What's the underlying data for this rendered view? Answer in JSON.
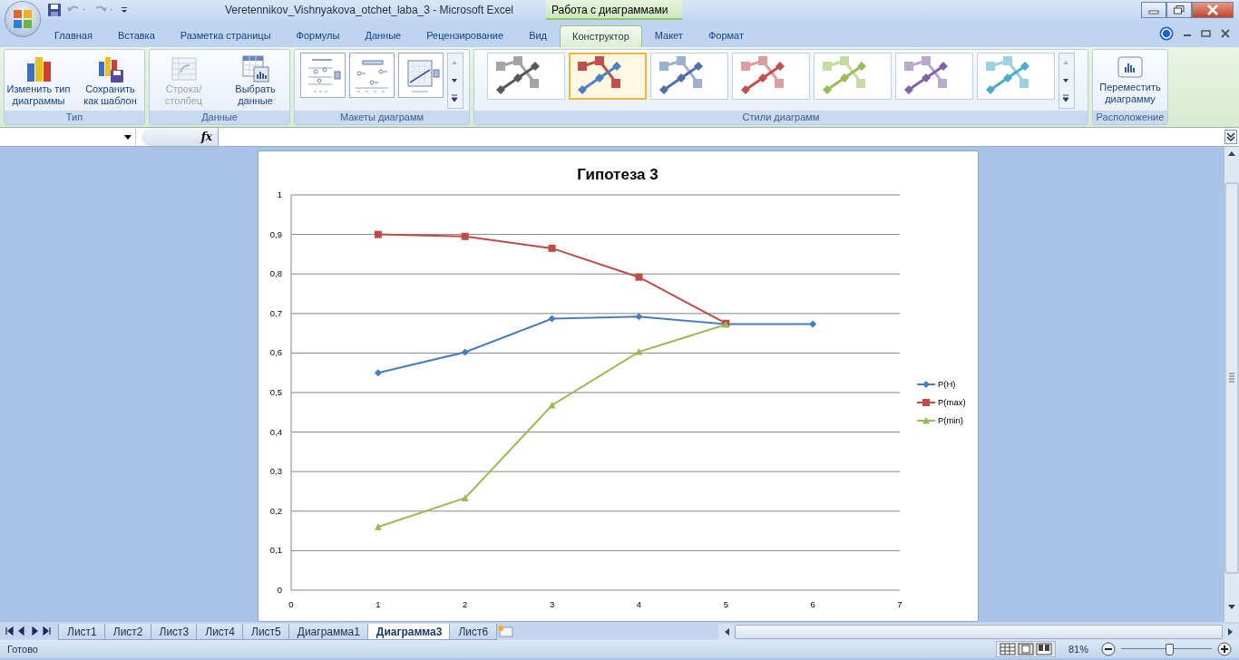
{
  "window": {
    "title": "Veretennikov_Vishnyakova_otchet_laba_3 - Microsoft Excel",
    "context_title": "Работа с диаграммами"
  },
  "tabs": [
    {
      "label": "Главная",
      "selected": false
    },
    {
      "label": "Вставка",
      "selected": false
    },
    {
      "label": "Разметка страницы",
      "selected": false
    },
    {
      "label": "Формулы",
      "selected": false
    },
    {
      "label": "Данные",
      "selected": false
    },
    {
      "label": "Рецензирование",
      "selected": false
    },
    {
      "label": "Вид",
      "selected": false
    },
    {
      "label": "Конструктор",
      "selected": true
    },
    {
      "label": "Макет",
      "selected": false
    },
    {
      "label": "Формат",
      "selected": false
    }
  ],
  "ribbon": {
    "groups": [
      {
        "title": "Тип",
        "kind": "buttons",
        "buttons": [
          {
            "label": "Изменить тип диаграммы",
            "kind": "bars",
            "disabled": false
          },
          {
            "label": "Сохранить как шаблон",
            "kind": "save",
            "disabled": false
          }
        ]
      },
      {
        "title": "Данные",
        "kind": "buttons",
        "buttons": [
          {
            "label": "Строка/столбец",
            "kind": "switch",
            "disabled": true
          },
          {
            "label": "Выбрать данные",
            "kind": "table",
            "disabled": false
          }
        ]
      },
      {
        "title": "Макеты диаграмм",
        "kind": "layouts"
      },
      {
        "title": "Стили диаграмм",
        "kind": "styles",
        "styles": [
          {
            "kind": "mono",
            "color": "#595959",
            "selected": false
          },
          {
            "kind": "multi",
            "color": "#4f81bd",
            "selected": true
          },
          {
            "kind": "mono",
            "color": "#4f6fa8",
            "selected": false
          },
          {
            "kind": "mono",
            "color": "#c0504d",
            "selected": false
          },
          {
            "kind": "mono",
            "color": "#9bbb59",
            "selected": false
          },
          {
            "kind": "mono",
            "color": "#8064a2",
            "selected": false
          },
          {
            "kind": "mono",
            "color": "#4bacc6",
            "selected": false
          }
        ]
      },
      {
        "title": "Расположение",
        "kind": "buttons",
        "buttons": [
          {
            "label": "Переместить диаграмму",
            "kind": "move",
            "disabled": false
          }
        ]
      }
    ]
  },
  "formula_bar": {
    "fx": "fx"
  },
  "chart": {
    "chart_data": {
      "type": "line",
      "title": "Гипотеза 3",
      "x": [
        1,
        2,
        3,
        4,
        5,
        6
      ],
      "series": [
        {
          "name": "P(H)",
          "color": "#4a7ebb",
          "marker": "diamond",
          "values": [
            0.55,
            0.602,
            0.687,
            0.692,
            0.673,
            0.673
          ]
        },
        {
          "name": "P(max)",
          "color": "#be4b48",
          "marker": "square",
          "values": [
            0.9,
            0.895,
            0.865,
            0.792,
            0.675,
            null
          ]
        },
        {
          "name": "P(min)",
          "color": "#98b954",
          "marker": "triangle",
          "values": [
            0.16,
            0.233,
            0.468,
            0.603,
            0.672,
            null
          ]
        }
      ],
      "grid": true,
      "legend": true,
      "xlim": [
        0,
        7
      ],
      "ylim": [
        0,
        1
      ],
      "xticks": [
        0,
        1,
        2,
        3,
        4,
        5,
        6,
        7
      ],
      "yticks": [
        {
          "value": 0,
          "label": "0"
        },
        {
          "value": 0.1,
          "label": "0,1"
        },
        {
          "value": 0.2,
          "label": "0,2"
        },
        {
          "value": 0.3,
          "label": "0,3"
        },
        {
          "value": 0.4,
          "label": "0,4"
        },
        {
          "value": 0.5,
          "label": "0,5"
        },
        {
          "value": 0.6,
          "label": "0,6"
        },
        {
          "value": 0.7,
          "label": "0,7"
        },
        {
          "value": 0.8,
          "label": "0,8"
        },
        {
          "value": 0.9,
          "label": "0,9"
        },
        {
          "value": 1,
          "label": "1"
        }
      ]
    }
  },
  "sheet_tabs": [
    {
      "label": "Лист1",
      "selected": false
    },
    {
      "label": "Лист2",
      "selected": false
    },
    {
      "label": "Лист3",
      "selected": false
    },
    {
      "label": "Лист4",
      "selected": false
    },
    {
      "label": "Лист5",
      "selected": false
    },
    {
      "label": "Диаграмма1",
      "selected": false
    },
    {
      "label": "Диаграмма3",
      "selected": true
    },
    {
      "label": "Лист6",
      "selected": false
    }
  ],
  "status_bar": {
    "status": "Готово",
    "zoom": "81%",
    "zoom_slider": {
      "level": 0.53
    }
  }
}
